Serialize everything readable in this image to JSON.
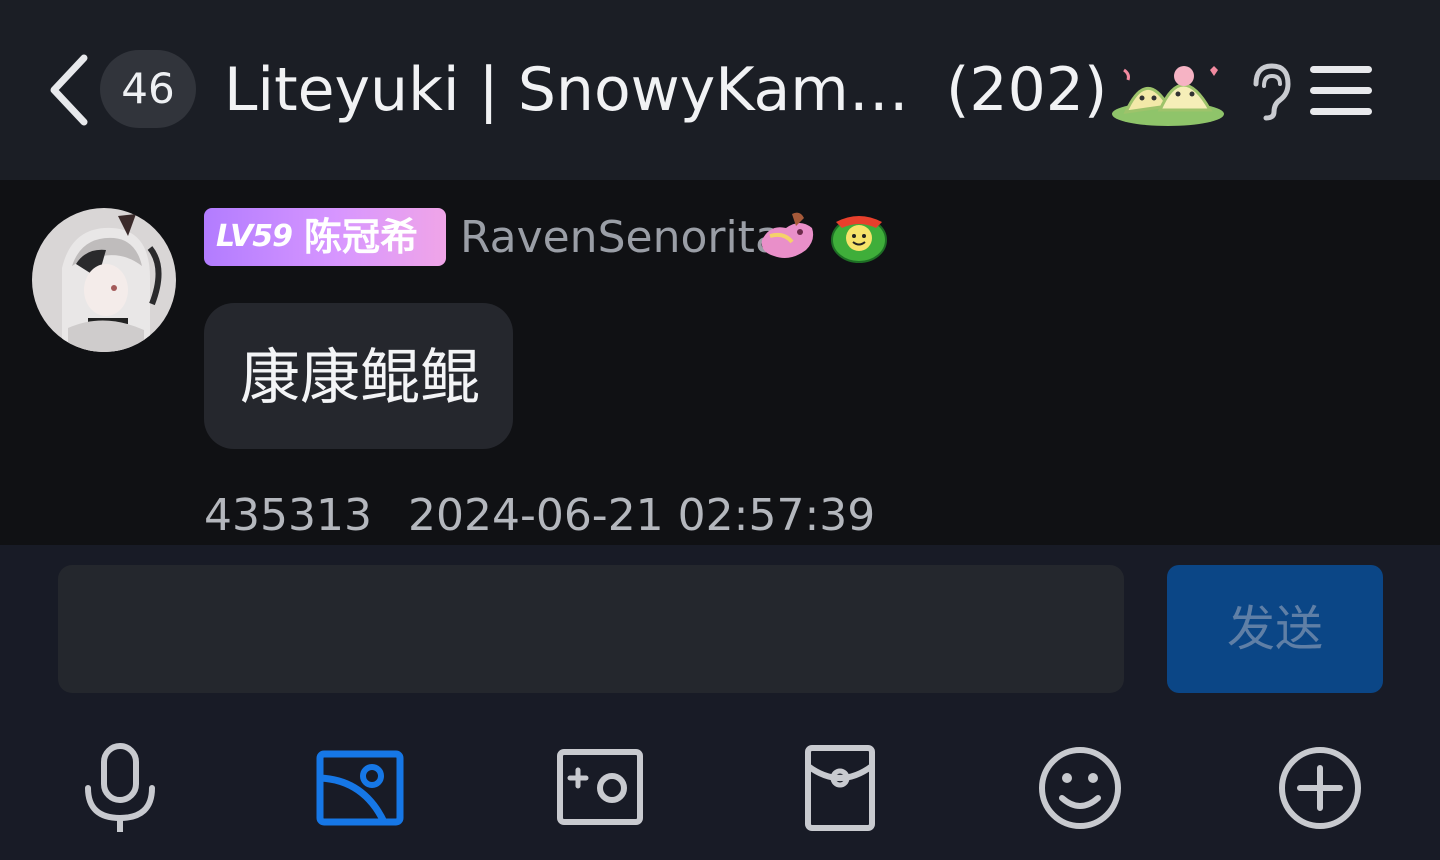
{
  "header": {
    "unread_count": "46",
    "title": "Liteyuki | SnowyKami |…",
    "member_count": "(202)"
  },
  "message": {
    "level_badge": "LV59",
    "rank_title": "陈冠希",
    "sender_name": "RavenSenorita",
    "text": "康康鲲鲲",
    "sender_id": "435313",
    "timestamp": "2024-06-21 02:57:39"
  },
  "composer": {
    "input_value": "",
    "send_label": "发送"
  },
  "toolbar": [
    "microphone-icon",
    "image-icon",
    "camera-icon",
    "red-packet-icon",
    "emoji-icon",
    "plus-icon"
  ],
  "colors": {
    "header_bg": "#1b1e25",
    "chat_bg": "#101114",
    "bubble_bg": "#25272d",
    "send_button_bg": "#0b4686",
    "active_tool": "#1677e6",
    "badge_gradient": [
      "#b27cff",
      "#f0a5e8"
    ]
  }
}
